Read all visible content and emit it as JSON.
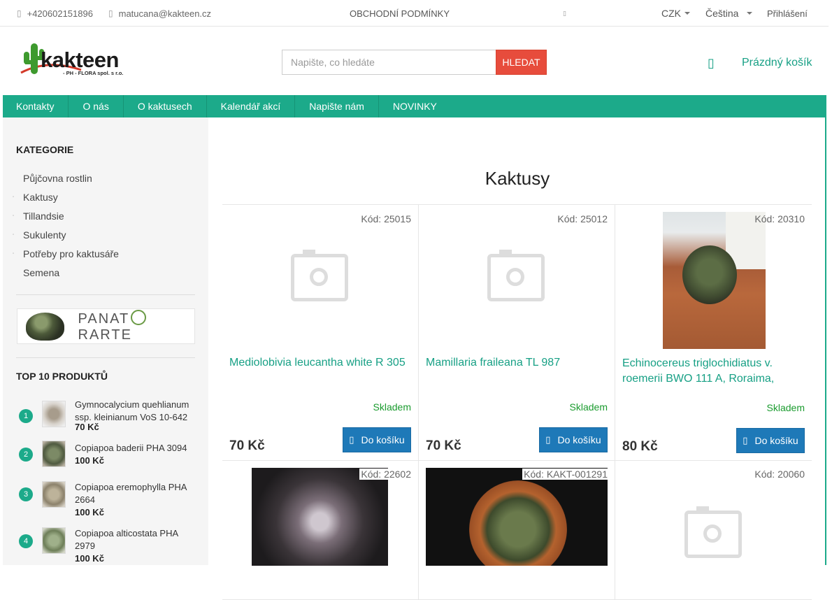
{
  "topbar": {
    "phone": "+420602151896",
    "email": "matucana@kakteen.cz",
    "terms": "OBCHODNÍ PODMÍNKY",
    "currency": "CZK",
    "language": "Čeština",
    "login": "Přihlášení"
  },
  "header": {
    "logo_word": "kakteen",
    "logo_sub": "- PH - FLORA spol. s r.o.",
    "search_placeholder": "Napište, co hledáte",
    "search_button": "HLEDAT",
    "cart_label": "Prázdný košík"
  },
  "nav": [
    "Kontakty",
    "O nás",
    "O kaktusech",
    "Kalendář akcí",
    "Napište nám",
    "NOVINKY"
  ],
  "sidebar": {
    "categories_title": "KATEGORIE",
    "categories": [
      "Půjčovna rostlin",
      "Kaktusy",
      "Tillandsie",
      "Sukulenty",
      "Potřeby pro kaktusáře",
      "Semena"
    ],
    "banner_text_left": "PANAT",
    "banner_text_right": "RARTE",
    "top_title": "TOP 10 PRODUKTŮ",
    "top": [
      {
        "num": "1",
        "name": "Gymnocalycium quehlianum ssp. kleinianum VoS 10-642",
        "price": "70 Kč"
      },
      {
        "num": "2",
        "name": "Copiapoa baderii PHA 3094",
        "price": "100 Kč"
      },
      {
        "num": "3",
        "name": "Copiapoa eremophylla PHA 2664",
        "price": "100 Kč"
      },
      {
        "num": "4",
        "name": "Copiapoa alticostata PHA 2979",
        "price": "100 Kč"
      }
    ]
  },
  "main": {
    "title": "Kaktusy",
    "products": [
      {
        "code": "Kód: 25015",
        "name": "Mediolobivia leucantha white R 305",
        "stock": "Skladem",
        "price": "70 Kč",
        "button": "Do košíku"
      },
      {
        "code": "Kód: 25012",
        "name": "Mamillaria fraileana TL 987",
        "stock": "Skladem",
        "price": "70 Kč",
        "button": "Do košíku"
      },
      {
        "code": "Kód: 20310",
        "name": "Echinocereus triglochidiatus v. roemerii BWO 111 A, Roraima,",
        "stock": "Skladem",
        "price": "80 Kč",
        "button": "Do košíku"
      },
      {
        "code": "Kód: 22602"
      },
      {
        "code": "Kód: KAKT-001291"
      },
      {
        "code": "Kód: 20060"
      }
    ]
  }
}
